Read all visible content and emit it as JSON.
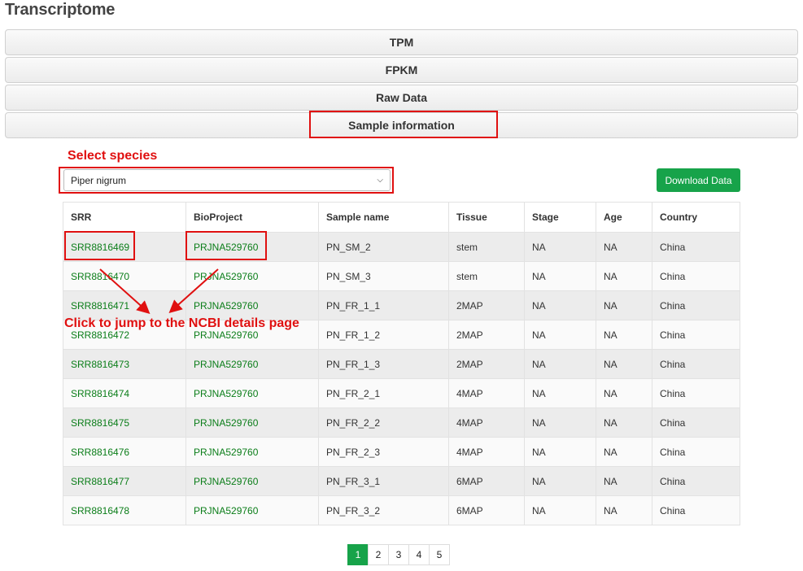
{
  "page": {
    "title": "Transcriptome"
  },
  "tabs": [
    "TPM",
    "FPKM",
    "Raw Data",
    "Sample information"
  ],
  "annotations": {
    "select_species": "Select species",
    "click_note": "Click to jump to the NCBI details page",
    "color": "#e01010"
  },
  "species_select": {
    "value": "Piper nigrum",
    "icon": "chevron-down-icon"
  },
  "download_button": {
    "label": "Download Data",
    "color": "#17a34a"
  },
  "table": {
    "headers": [
      "SRR",
      "BioProject",
      "Sample name",
      "Tissue",
      "Stage",
      "Age",
      "Country"
    ],
    "rows": [
      [
        "SRR8816469",
        "PRJNA529760",
        "PN_SM_2",
        "stem",
        "NA",
        "NA",
        "China"
      ],
      [
        "SRR8816470",
        "PRJNA529760",
        "PN_SM_3",
        "stem",
        "NA",
        "NA",
        "China"
      ],
      [
        "SRR8816471",
        "PRJNA529760",
        "PN_FR_1_1",
        "2MAP",
        "NA",
        "NA",
        "China"
      ],
      [
        "SRR8816472",
        "PRJNA529760",
        "PN_FR_1_2",
        "2MAP",
        "NA",
        "NA",
        "China"
      ],
      [
        "SRR8816473",
        "PRJNA529760",
        "PN_FR_1_3",
        "2MAP",
        "NA",
        "NA",
        "China"
      ],
      [
        "SRR8816474",
        "PRJNA529760",
        "PN_FR_2_1",
        "4MAP",
        "NA",
        "NA",
        "China"
      ],
      [
        "SRR8816475",
        "PRJNA529760",
        "PN_FR_2_2",
        "4MAP",
        "NA",
        "NA",
        "China"
      ],
      [
        "SRR8816476",
        "PRJNA529760",
        "PN_FR_2_3",
        "4MAP",
        "NA",
        "NA",
        "China"
      ],
      [
        "SRR8816477",
        "PRJNA529760",
        "PN_FR_3_1",
        "6MAP",
        "NA",
        "NA",
        "China"
      ],
      [
        "SRR8816478",
        "PRJNA529760",
        "PN_FR_3_2",
        "6MAP",
        "NA",
        "NA",
        "China"
      ]
    ],
    "link_color": "#0a7d18"
  },
  "pagination": {
    "pages": [
      "1",
      "2",
      "3",
      "4",
      "5"
    ],
    "active": "1"
  }
}
